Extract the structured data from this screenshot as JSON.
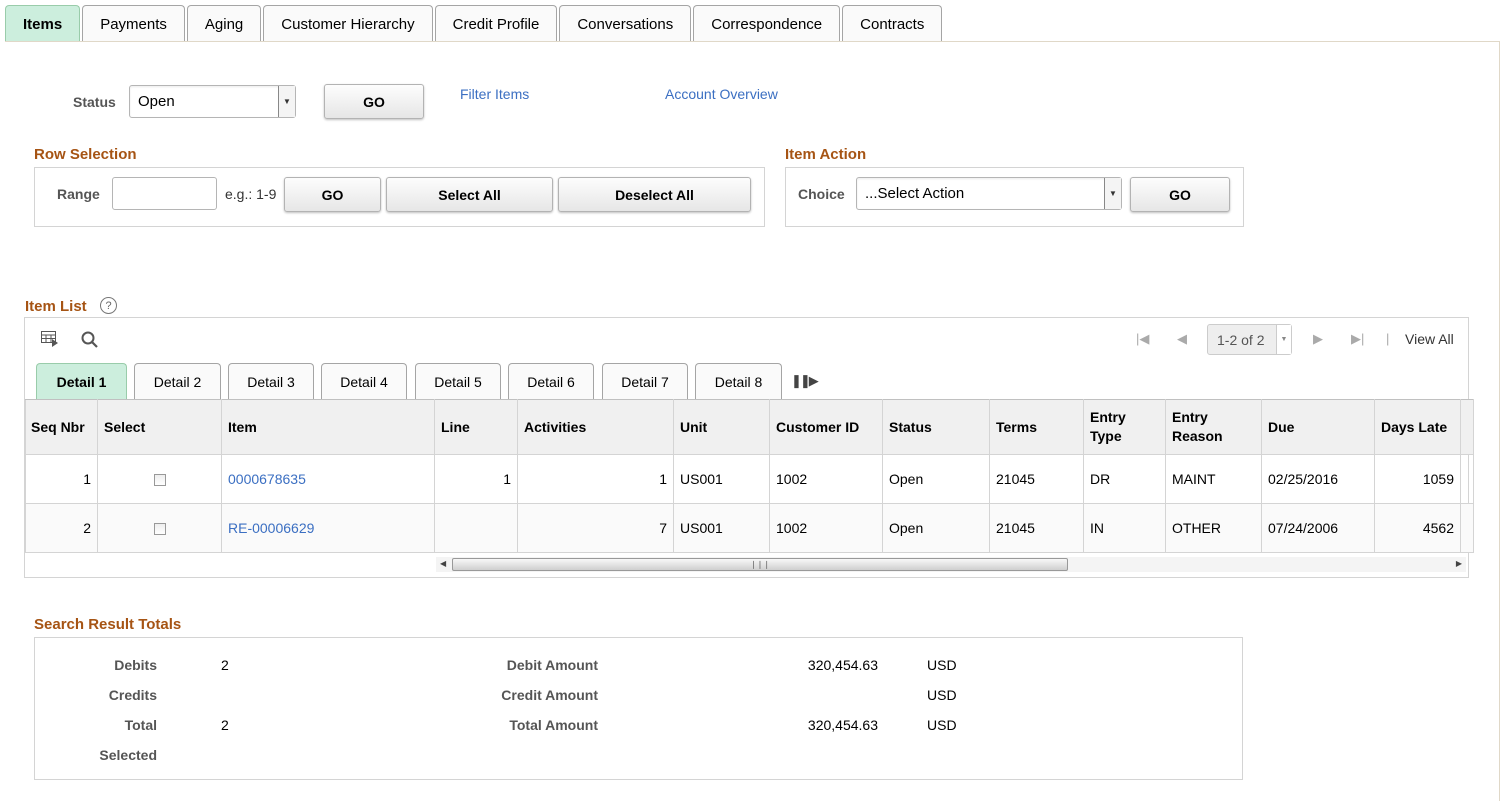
{
  "top_tabs": [
    {
      "label": "Items",
      "active": true
    },
    {
      "label": "Payments"
    },
    {
      "label": "Aging"
    },
    {
      "label": "Customer Hierarchy"
    },
    {
      "label": "Credit Profile"
    },
    {
      "label": "Conversations"
    },
    {
      "label": "Correspondence"
    },
    {
      "label": "Contracts"
    }
  ],
  "status_filter": {
    "label": "Status",
    "value": "Open",
    "go_label": "GO",
    "filter_items_link": "Filter Items",
    "account_overview_link": "Account Overview"
  },
  "row_selection": {
    "title": "Row Selection",
    "range_label": "Range",
    "range_value": "",
    "hint": "e.g.: 1-9",
    "go_label": "GO",
    "select_all_label": "Select All",
    "deselect_all_label": "Deselect All"
  },
  "item_action": {
    "title": "Item Action",
    "choice_label": "Choice",
    "choice_value": "...Select Action",
    "go_label": "GO"
  },
  "item_list": {
    "title": "Item List",
    "pager_text": "1-2 of 2",
    "view_all": "View All",
    "pager_separator": "|",
    "detail_tabs": [
      "Detail 1",
      "Detail 2",
      "Detail 3",
      "Detail 4",
      "Detail 5",
      "Detail 6",
      "Detail 7",
      "Detail 8"
    ],
    "columns": [
      "Seq Nbr",
      "Select",
      "Item",
      "Line",
      "Activities",
      "Unit",
      "Customer ID",
      "Status",
      "Terms",
      "Entry Type",
      "Entry Reason",
      "Due",
      "Days Late"
    ],
    "rows": [
      {
        "seq": "1",
        "selected": false,
        "item": "0000678635",
        "line": "1",
        "activities": "1",
        "unit": "US001",
        "customer_id": "1002",
        "status": "Open",
        "terms": "21045",
        "entry_type": "DR",
        "entry_reason": "MAINT",
        "due": "02/25/2016",
        "days_late": "1059"
      },
      {
        "seq": "2",
        "selected": false,
        "item": "RE-00006629",
        "line": "",
        "activities": "7",
        "unit": "US001",
        "customer_id": "1002",
        "status": "Open",
        "terms": "21045",
        "entry_type": "IN",
        "entry_reason": "OTHER",
        "due": "07/24/2006",
        "days_late": "4562"
      }
    ]
  },
  "totals": {
    "title": "Search Result Totals",
    "debits_label": "Debits",
    "debits": "2",
    "credits_label": "Credits",
    "credits": "",
    "total_label": "Total",
    "total": "2",
    "selected_label": "Selected",
    "selected": "",
    "debit_amount_label": "Debit Amount",
    "debit_amount": "320,454.63",
    "debit_currency": "USD",
    "credit_amount_label": "Credit Amount",
    "credit_amount": "",
    "credit_currency": "USD",
    "total_amount_label": "Total Amount",
    "total_amount": "320,454.63",
    "total_currency": "USD"
  },
  "colors": {
    "active_tab": "#cceedd",
    "section_title": "#a65414",
    "link": "#3b6fc2"
  }
}
